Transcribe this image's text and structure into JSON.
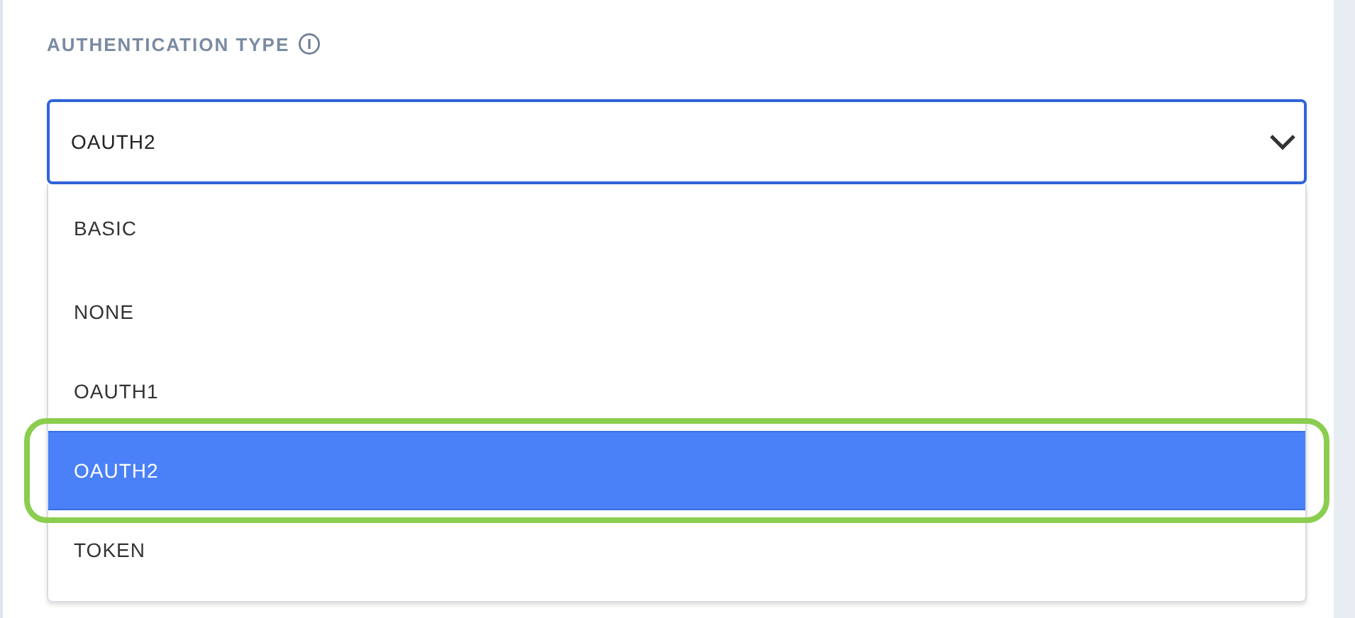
{
  "field": {
    "label": "AUTHENTICATION TYPE",
    "value": "OAUTH2",
    "expanded": true
  },
  "options": [
    {
      "label": "BASIC",
      "selected": false,
      "annotated": false
    },
    {
      "label": "NONE",
      "selected": false,
      "annotated": false
    },
    {
      "label": "OAUTH1",
      "selected": false,
      "annotated": false
    },
    {
      "label": "OAUTH2",
      "selected": true,
      "annotated": true
    },
    {
      "label": "TOKEN",
      "selected": false,
      "annotated": false
    }
  ]
}
